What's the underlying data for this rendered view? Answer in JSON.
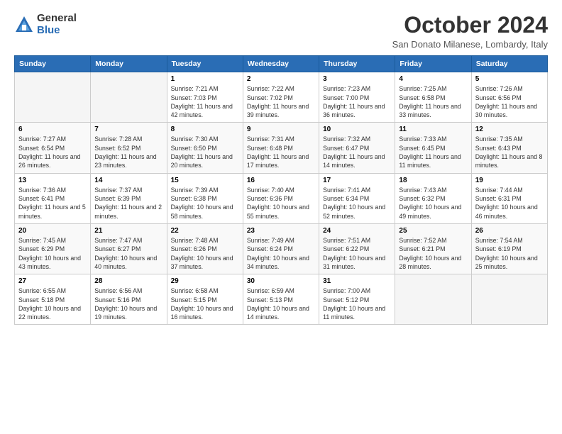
{
  "logo": {
    "general": "General",
    "blue": "Blue"
  },
  "header": {
    "title": "October 2024",
    "location": "San Donato Milanese, Lombardy, Italy"
  },
  "weekdays": [
    "Sunday",
    "Monday",
    "Tuesday",
    "Wednesday",
    "Thursday",
    "Friday",
    "Saturday"
  ],
  "weeks": [
    [
      {
        "day": "",
        "info": ""
      },
      {
        "day": "",
        "info": ""
      },
      {
        "day": "1",
        "info": "Sunrise: 7:21 AM\nSunset: 7:03 PM\nDaylight: 11 hours and 42 minutes."
      },
      {
        "day": "2",
        "info": "Sunrise: 7:22 AM\nSunset: 7:02 PM\nDaylight: 11 hours and 39 minutes."
      },
      {
        "day": "3",
        "info": "Sunrise: 7:23 AM\nSunset: 7:00 PM\nDaylight: 11 hours and 36 minutes."
      },
      {
        "day": "4",
        "info": "Sunrise: 7:25 AM\nSunset: 6:58 PM\nDaylight: 11 hours and 33 minutes."
      },
      {
        "day": "5",
        "info": "Sunrise: 7:26 AM\nSunset: 6:56 PM\nDaylight: 11 hours and 30 minutes."
      }
    ],
    [
      {
        "day": "6",
        "info": "Sunrise: 7:27 AM\nSunset: 6:54 PM\nDaylight: 11 hours and 26 minutes."
      },
      {
        "day": "7",
        "info": "Sunrise: 7:28 AM\nSunset: 6:52 PM\nDaylight: 11 hours and 23 minutes."
      },
      {
        "day": "8",
        "info": "Sunrise: 7:30 AM\nSunset: 6:50 PM\nDaylight: 11 hours and 20 minutes."
      },
      {
        "day": "9",
        "info": "Sunrise: 7:31 AM\nSunset: 6:48 PM\nDaylight: 11 hours and 17 minutes."
      },
      {
        "day": "10",
        "info": "Sunrise: 7:32 AM\nSunset: 6:47 PM\nDaylight: 11 hours and 14 minutes."
      },
      {
        "day": "11",
        "info": "Sunrise: 7:33 AM\nSunset: 6:45 PM\nDaylight: 11 hours and 11 minutes."
      },
      {
        "day": "12",
        "info": "Sunrise: 7:35 AM\nSunset: 6:43 PM\nDaylight: 11 hours and 8 minutes."
      }
    ],
    [
      {
        "day": "13",
        "info": "Sunrise: 7:36 AM\nSunset: 6:41 PM\nDaylight: 11 hours and 5 minutes."
      },
      {
        "day": "14",
        "info": "Sunrise: 7:37 AM\nSunset: 6:39 PM\nDaylight: 11 hours and 2 minutes."
      },
      {
        "day": "15",
        "info": "Sunrise: 7:39 AM\nSunset: 6:38 PM\nDaylight: 10 hours and 58 minutes."
      },
      {
        "day": "16",
        "info": "Sunrise: 7:40 AM\nSunset: 6:36 PM\nDaylight: 10 hours and 55 minutes."
      },
      {
        "day": "17",
        "info": "Sunrise: 7:41 AM\nSunset: 6:34 PM\nDaylight: 10 hours and 52 minutes."
      },
      {
        "day": "18",
        "info": "Sunrise: 7:43 AM\nSunset: 6:32 PM\nDaylight: 10 hours and 49 minutes."
      },
      {
        "day": "19",
        "info": "Sunrise: 7:44 AM\nSunset: 6:31 PM\nDaylight: 10 hours and 46 minutes."
      }
    ],
    [
      {
        "day": "20",
        "info": "Sunrise: 7:45 AM\nSunset: 6:29 PM\nDaylight: 10 hours and 43 minutes."
      },
      {
        "day": "21",
        "info": "Sunrise: 7:47 AM\nSunset: 6:27 PM\nDaylight: 10 hours and 40 minutes."
      },
      {
        "day": "22",
        "info": "Sunrise: 7:48 AM\nSunset: 6:26 PM\nDaylight: 10 hours and 37 minutes."
      },
      {
        "day": "23",
        "info": "Sunrise: 7:49 AM\nSunset: 6:24 PM\nDaylight: 10 hours and 34 minutes."
      },
      {
        "day": "24",
        "info": "Sunrise: 7:51 AM\nSunset: 6:22 PM\nDaylight: 10 hours and 31 minutes."
      },
      {
        "day": "25",
        "info": "Sunrise: 7:52 AM\nSunset: 6:21 PM\nDaylight: 10 hours and 28 minutes."
      },
      {
        "day": "26",
        "info": "Sunrise: 7:54 AM\nSunset: 6:19 PM\nDaylight: 10 hours and 25 minutes."
      }
    ],
    [
      {
        "day": "27",
        "info": "Sunrise: 6:55 AM\nSunset: 5:18 PM\nDaylight: 10 hours and 22 minutes."
      },
      {
        "day": "28",
        "info": "Sunrise: 6:56 AM\nSunset: 5:16 PM\nDaylight: 10 hours and 19 minutes."
      },
      {
        "day": "29",
        "info": "Sunrise: 6:58 AM\nSunset: 5:15 PM\nDaylight: 10 hours and 16 minutes."
      },
      {
        "day": "30",
        "info": "Sunrise: 6:59 AM\nSunset: 5:13 PM\nDaylight: 10 hours and 14 minutes."
      },
      {
        "day": "31",
        "info": "Sunrise: 7:00 AM\nSunset: 5:12 PM\nDaylight: 10 hours and 11 minutes."
      },
      {
        "day": "",
        "info": ""
      },
      {
        "day": "",
        "info": ""
      }
    ]
  ]
}
